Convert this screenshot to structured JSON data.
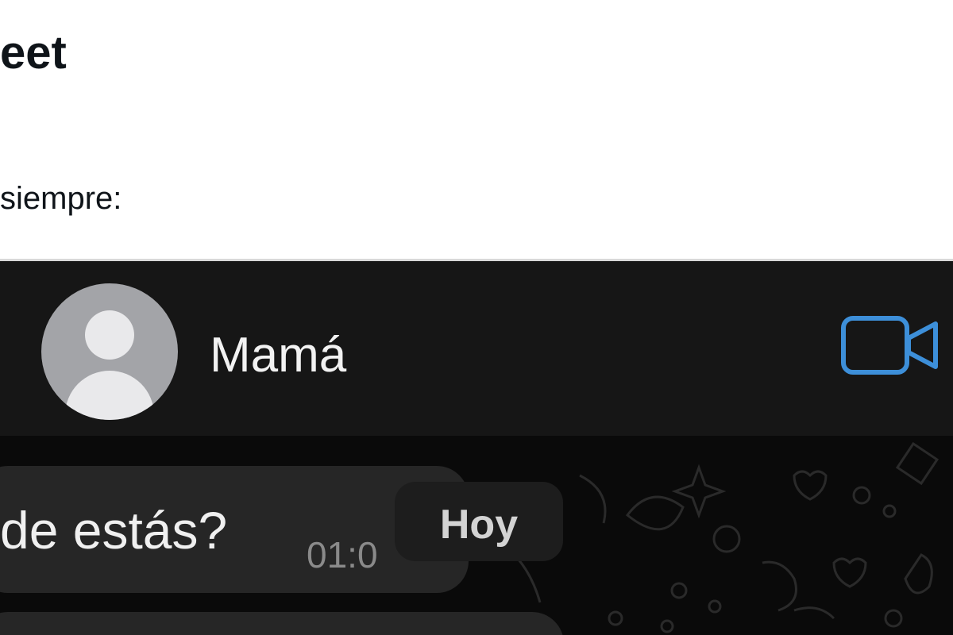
{
  "tweet": {
    "heading": "eet",
    "text": "siempre:"
  },
  "chat": {
    "contact_name": "Mamá",
    "message_text": "de estás?",
    "message_time": "01:0",
    "date_label": "Hoy"
  },
  "colors": {
    "accent_blue": "#3d8fd9",
    "header_bg": "#161616",
    "chat_bg": "#0a0a0a",
    "bubble_bg": "#262626"
  },
  "icons": {
    "video_call": "video-camera-icon",
    "avatar": "default-avatar-icon"
  }
}
